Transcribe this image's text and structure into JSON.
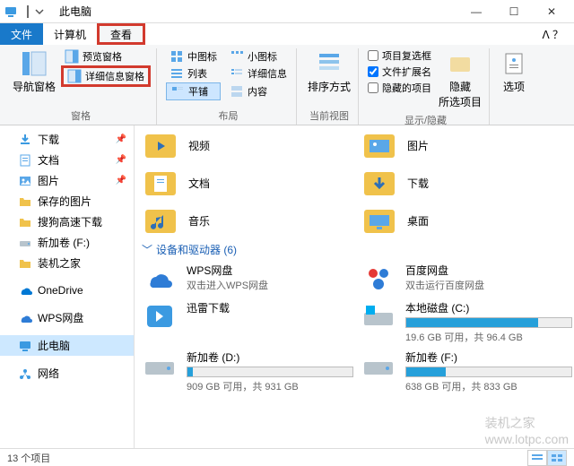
{
  "window": {
    "title": "此电脑"
  },
  "tabs": {
    "file": "文件",
    "computer": "计算机",
    "view": "查看"
  },
  "ribbon": {
    "nav_pane": "导航窗格",
    "preview_pane": "预览窗格",
    "details_pane": "详细信息窗格",
    "panes_label": "窗格",
    "medium_icons": "中图标",
    "small_icons": "小图标",
    "list": "列表",
    "details": "详细信息",
    "tiles": "平铺",
    "content": "内容",
    "layout_label": "布局",
    "sort_by": "排序方式",
    "current_view_label": "当前视图",
    "item_checkboxes": "项目复选框",
    "file_ext": "文件扩展名",
    "hidden_items": "隐藏的项目",
    "hide_selected": "隐藏\n所选项目",
    "show_hide_label": "显示/隐藏",
    "options": "选项"
  },
  "sidebar": {
    "items": [
      {
        "label": "下载",
        "icon": "downloads",
        "pin": true
      },
      {
        "label": "文档",
        "icon": "documents",
        "pin": true
      },
      {
        "label": "图片",
        "icon": "pictures",
        "pin": true
      },
      {
        "label": "保存的图片",
        "icon": "folder"
      },
      {
        "label": "搜狗高速下载",
        "icon": "folder"
      },
      {
        "label": "新加卷 (F:)",
        "icon": "drive"
      },
      {
        "label": "装机之家",
        "icon": "folder"
      },
      {
        "label": "OneDrive",
        "icon": "onedrive",
        "gap": true
      },
      {
        "label": "WPS网盘",
        "icon": "wps",
        "gap": true
      },
      {
        "label": "此电脑",
        "icon": "thispc",
        "gap": true,
        "selected": true
      },
      {
        "label": "网络",
        "icon": "network",
        "gap": true
      }
    ]
  },
  "folders": [
    {
      "name": "视频",
      "icon": "videos"
    },
    {
      "name": "图片",
      "icon": "pictures"
    },
    {
      "name": "文档",
      "icon": "documents"
    },
    {
      "name": "下载",
      "icon": "downloads"
    },
    {
      "name": "音乐",
      "icon": "music"
    },
    {
      "name": "桌面",
      "icon": "desktop"
    }
  ],
  "devices_header": "设备和驱动器 (6)",
  "devices": [
    {
      "name": "WPS网盘",
      "sub": "双击进入WPS网盘",
      "icon": "wps-cloud"
    },
    {
      "name": "百度网盘",
      "sub": "双击运行百度网盘",
      "icon": "baidu"
    },
    {
      "name": "迅雷下载",
      "sub": "",
      "icon": "xunlei"
    },
    {
      "name": "本地磁盘 (C:)",
      "sub": "19.6 GB 可用，共 96.4 GB",
      "icon": "drive-win",
      "bar": 80
    },
    {
      "name": "新加卷 (D:)",
      "sub": "909 GB 可用，共 931 GB",
      "icon": "drive",
      "bar": 3
    },
    {
      "name": "新加卷 (F:)",
      "sub": "638 GB 可用，共 833 GB",
      "icon": "drive",
      "bar": 24
    }
  ],
  "status": {
    "count": "13 个项目"
  },
  "watermark": "装机之家\nwww.lotpc.com"
}
